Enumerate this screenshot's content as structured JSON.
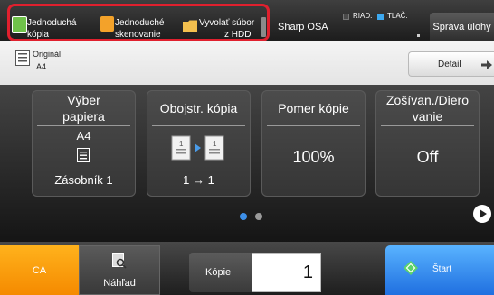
{
  "apps": [
    {
      "line1": "Jednoduchá",
      "line2": "kópia"
    },
    {
      "line1": "Jednoduché",
      "line2": "skenovanie"
    },
    {
      "line1": "Vyvolať súbor",
      "line2": "z HDD"
    }
  ],
  "osa_label": "Sharp OSA",
  "status": {
    "riad": "RIAD.",
    "tlac": "TLAČ."
  },
  "manage_label": "Správa úlohy",
  "original": {
    "label": "Originál",
    "size": "A4"
  },
  "detail_label": "Detail",
  "tiles": [
    {
      "title_line1": "Výber",
      "title_line2": "papiera",
      "size": "A4",
      "value": "Zásobník 1"
    },
    {
      "title": "Obojstr. kópia",
      "value": "1 → 1"
    },
    {
      "title": "Pomer kópie",
      "value": "100%"
    },
    {
      "title_line1": "Zošívan./Diero",
      "title_line2": "vanie",
      "value": "Off"
    }
  ],
  "bottom": {
    "ca_label": "CA",
    "preview_label": "Náhľad",
    "copies_label": "Kópie",
    "copies_value": "1",
    "start_label": "Štart"
  },
  "colors": {
    "highlight": "#e0202e",
    "ca": "#f7a011",
    "start": "#3c8fee",
    "dot_active": "#3d8fe8"
  }
}
